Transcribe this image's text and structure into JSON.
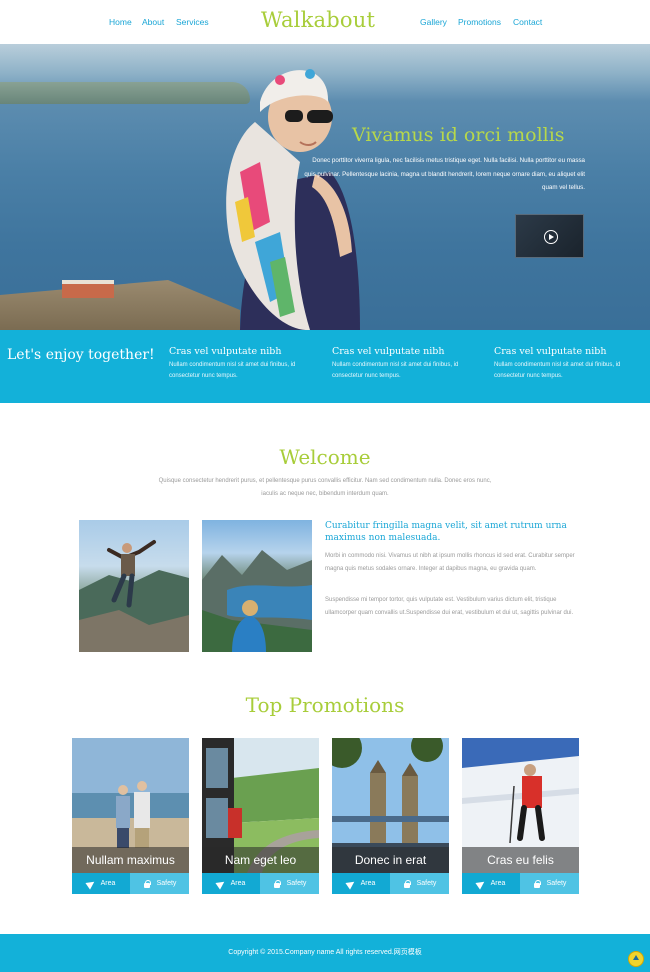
{
  "header": {
    "brand": "Walkabout",
    "nav_left": [
      "Home",
      "About",
      "Services"
    ],
    "nav_right": [
      "Gallery",
      "Promotions",
      "Contact"
    ],
    "accent": "#a8cd3a",
    "link_color": "#1aa6d6"
  },
  "hero": {
    "title": "Vivamus id orci mollis",
    "text": "Donec porttitor viverra ligula, nec facilisis metus tristique eget. Nulla facilisi. Nulla porttitor eu massa quis pulvinar. Pellentesque lacinia, magna ut blandit hendrerit, lorem neque ornare diam, eu aliquet elit quam vel tellus.",
    "video_icon": "play-icon"
  },
  "band": {
    "title": "Let's enjoy together!",
    "columns": [
      {
        "heading": "Cras vel vulputate nibh",
        "text": "Nullam condimentum nisl sit amet dui finibus, id consectetur nunc tempus."
      },
      {
        "heading": "Cras vel vulputate nibh",
        "text": "Nullam condimentum nisl sit amet dui finibus, id consectetur nunc tempus."
      },
      {
        "heading": "Cras vel vulputate nibh",
        "text": "Nullam condimentum nisl sit amet dui finibus, id consectetur nunc tempus."
      }
    ],
    "color": "#13b1d9"
  },
  "welcome": {
    "title": "Welcome",
    "subtitle": "Quisque consectetur hendrerit purus, et pellentesque purus convallis efficitur. Nam sed condimentum nulla. Donec eros nunc, iaculis ac neque nec, bibendum interdum quam.",
    "heading": "Curabitur fringilla magna velit, sit amet rutrum urna maximus non malesuada.",
    "paragraph1": "Morbi in commodo nisi. Vivamus ut nibh at ipsum mollis rhoncus id sed erat. Curabitur semper magna quis metus sodales ornare. Integer at dapibus magna, eu gravida quam.",
    "paragraph2": "Suspendisse mi tempor tortor, quis vulputate est. Vestibulum varius dictum elit, tristique ullamcorper quam convallis ut.Suspendisse dui erat, vestibulum et dui ut, sagittis pulvinar dui."
  },
  "promotions": {
    "title": "Top Promotions",
    "area_label": "Area",
    "safety_label": "Safety",
    "cards": [
      {
        "caption": "Nullam maximus"
      },
      {
        "caption": "Nam eget leo"
      },
      {
        "caption": "Donec in erat"
      },
      {
        "caption": "Cras eu felis"
      }
    ]
  },
  "footer": {
    "text": "Copyright © 2015.Company name All rights reserved.网页模板",
    "top_icon": "arrow-up-icon"
  }
}
